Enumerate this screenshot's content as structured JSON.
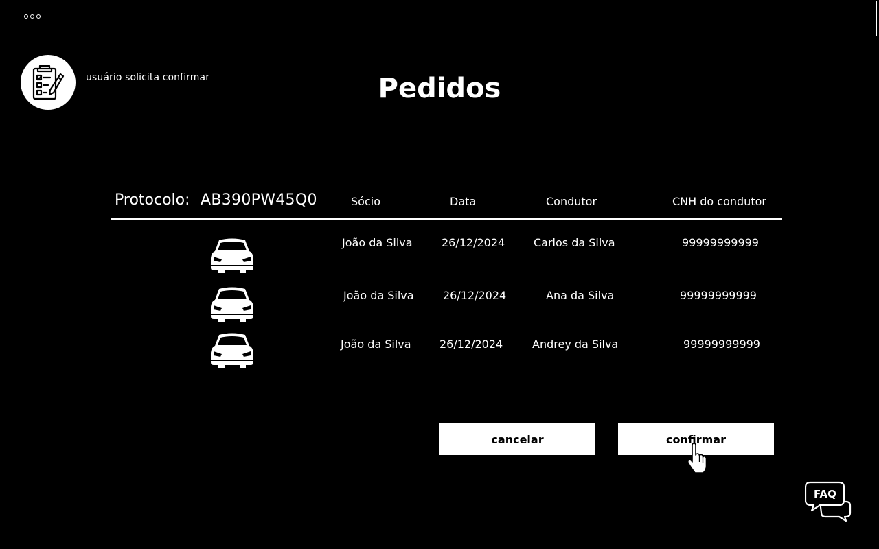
{
  "window": {
    "controls": [
      "dot",
      "dot",
      "dot"
    ]
  },
  "header": {
    "subtitle": "usuário solicita confirmar",
    "title": "Pedidos",
    "logo_icon": "clipboard-checklist-icon"
  },
  "table": {
    "protocol_label": "Protocolo:",
    "protocol_value": "AB390PW45Q0",
    "columns": [
      "Sócio",
      "Data",
      "Condutor",
      "CNH do condutor"
    ],
    "rows": [
      {
        "icon": "car-icon",
        "socio": "João da Silva",
        "data": "26/12/2024",
        "condutor": "Carlos da Silva",
        "cnh": "99999999999"
      },
      {
        "icon": "car-icon",
        "socio": "João da Silva",
        "data": "26/12/2024",
        "condutor": "Ana da Silva",
        "cnh": "99999999999"
      },
      {
        "icon": "car-icon",
        "socio": "João da Silva",
        "data": "26/12/2024",
        "condutor": "Andrey da Silva",
        "cnh": "99999999999"
      }
    ]
  },
  "actions": {
    "cancel_label": "cancelar",
    "confirm_label": "confirmar"
  },
  "faq": {
    "label": "FAQ",
    "icon": "chat-bubbles-icon"
  },
  "colors": {
    "background": "#000000",
    "foreground": "#ffffff"
  }
}
